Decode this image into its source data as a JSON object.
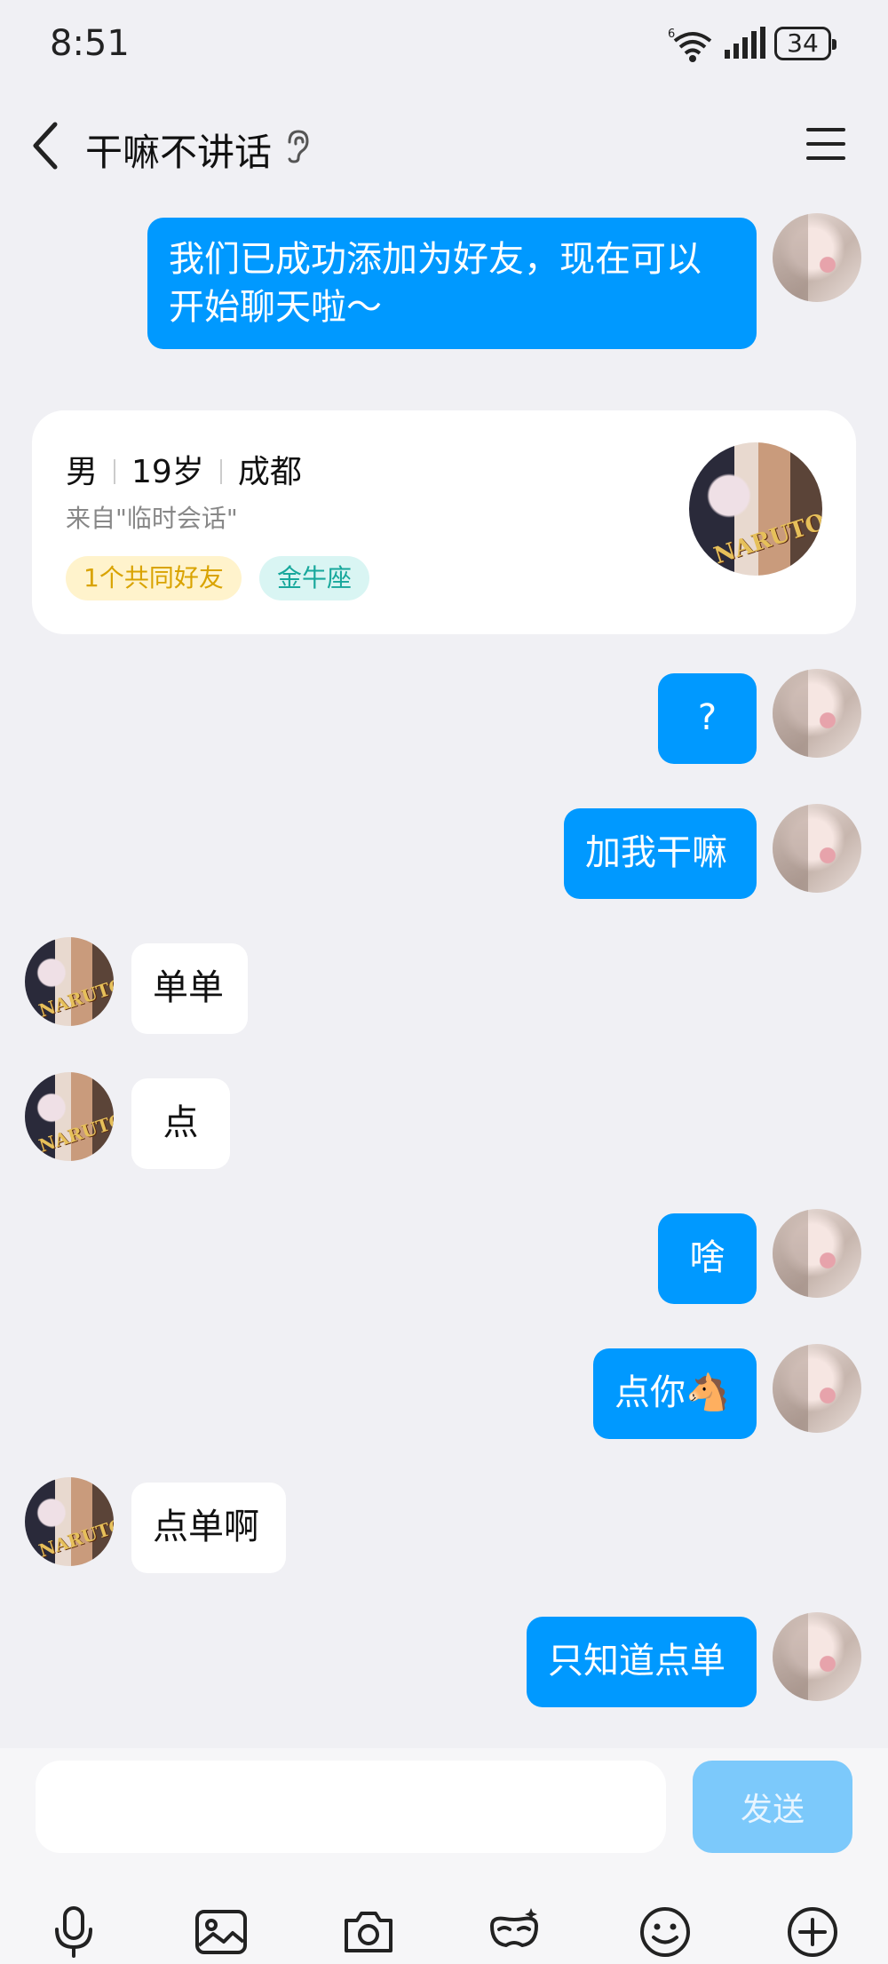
{
  "status_bar": {
    "time": "8:51",
    "network": "6",
    "battery": "34"
  },
  "header": {
    "title": "干嘛不讲话"
  },
  "messages": [
    {
      "text_line1": "我们已成功添加为好友，现在可以",
      "text_line2": "开始聊天啦～"
    },
    {
      "text": "?"
    },
    {
      "text": "加我干嘛"
    },
    {
      "text": "单单"
    },
    {
      "text": "点"
    },
    {
      "text": "啥"
    },
    {
      "text": "点你🐴"
    },
    {
      "text": "点单啊"
    },
    {
      "text": "只知道点单"
    }
  ],
  "profile_card": {
    "gender": "男",
    "age": "19岁",
    "city": "成都",
    "source": "来自\"临时会话\"",
    "tags": [
      "1个共同好友",
      "金牛座"
    ],
    "avatar_text": "NARUTO"
  },
  "composer": {
    "input_placeholder": "",
    "send_label": "发送"
  },
  "toolbar": [
    "microphone-icon",
    "image-icon",
    "camera-icon",
    "mask-icon",
    "emoji-icon",
    "plus-icon"
  ],
  "colors": {
    "outgoing_bubble": "#0099ff",
    "incoming_bubble": "#ffffff",
    "background": "#f0f0f4",
    "send_disabled": "#7cc9fb"
  }
}
